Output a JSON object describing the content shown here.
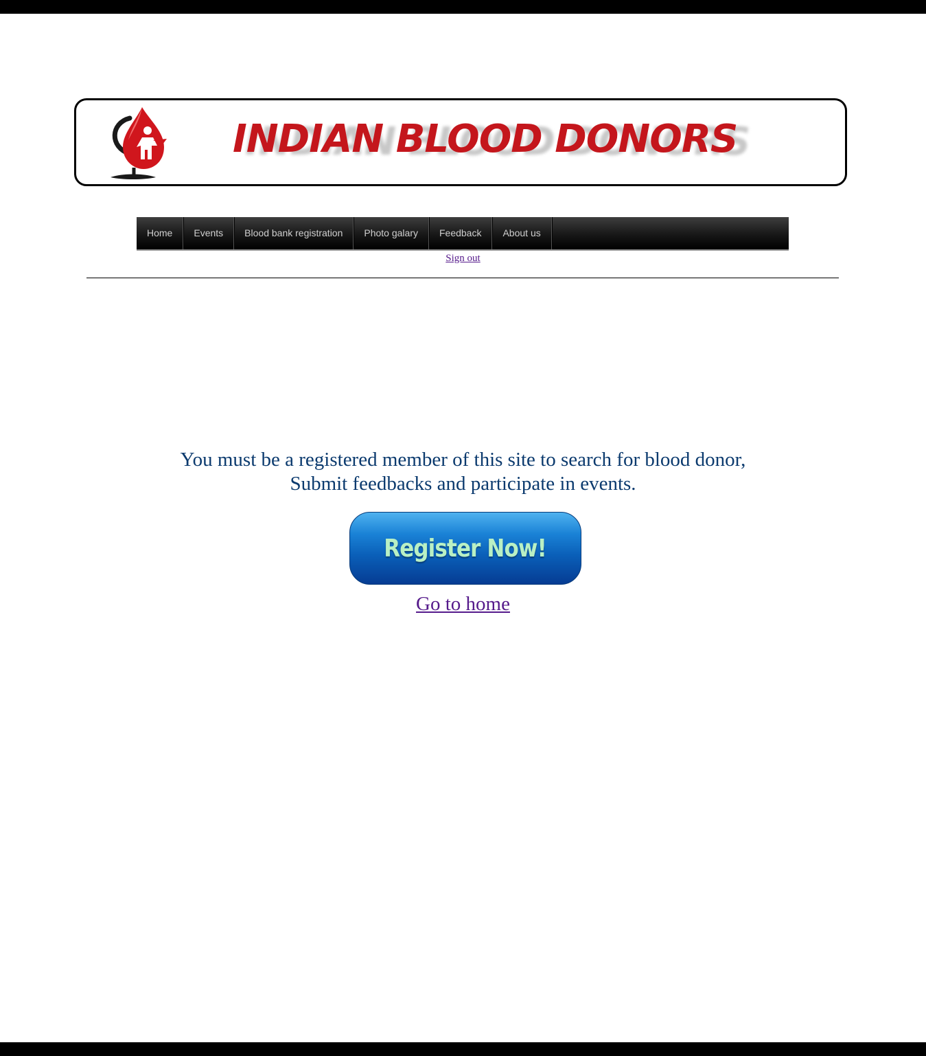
{
  "site": {
    "banner_title": "INDIAN BLOOD DONORS"
  },
  "nav": {
    "items": [
      {
        "label": "Home"
      },
      {
        "label": "Events"
      },
      {
        "label": "Blood bank registration"
      },
      {
        "label": "Photo galary"
      },
      {
        "label": "Feedback"
      },
      {
        "label": "About us"
      }
    ],
    "signout_label": "Sign out"
  },
  "main": {
    "message_line1": "You must be a registered member of this site to search for blood donor,",
    "message_line2": "Submit feedbacks and participate in events.",
    "register_label": "Register Now!",
    "home_link_label": "Go to home"
  },
  "colors": {
    "brand_red": "#c4161c",
    "message_blue": "#0b3a6e",
    "visited_link": "#551a8b"
  }
}
